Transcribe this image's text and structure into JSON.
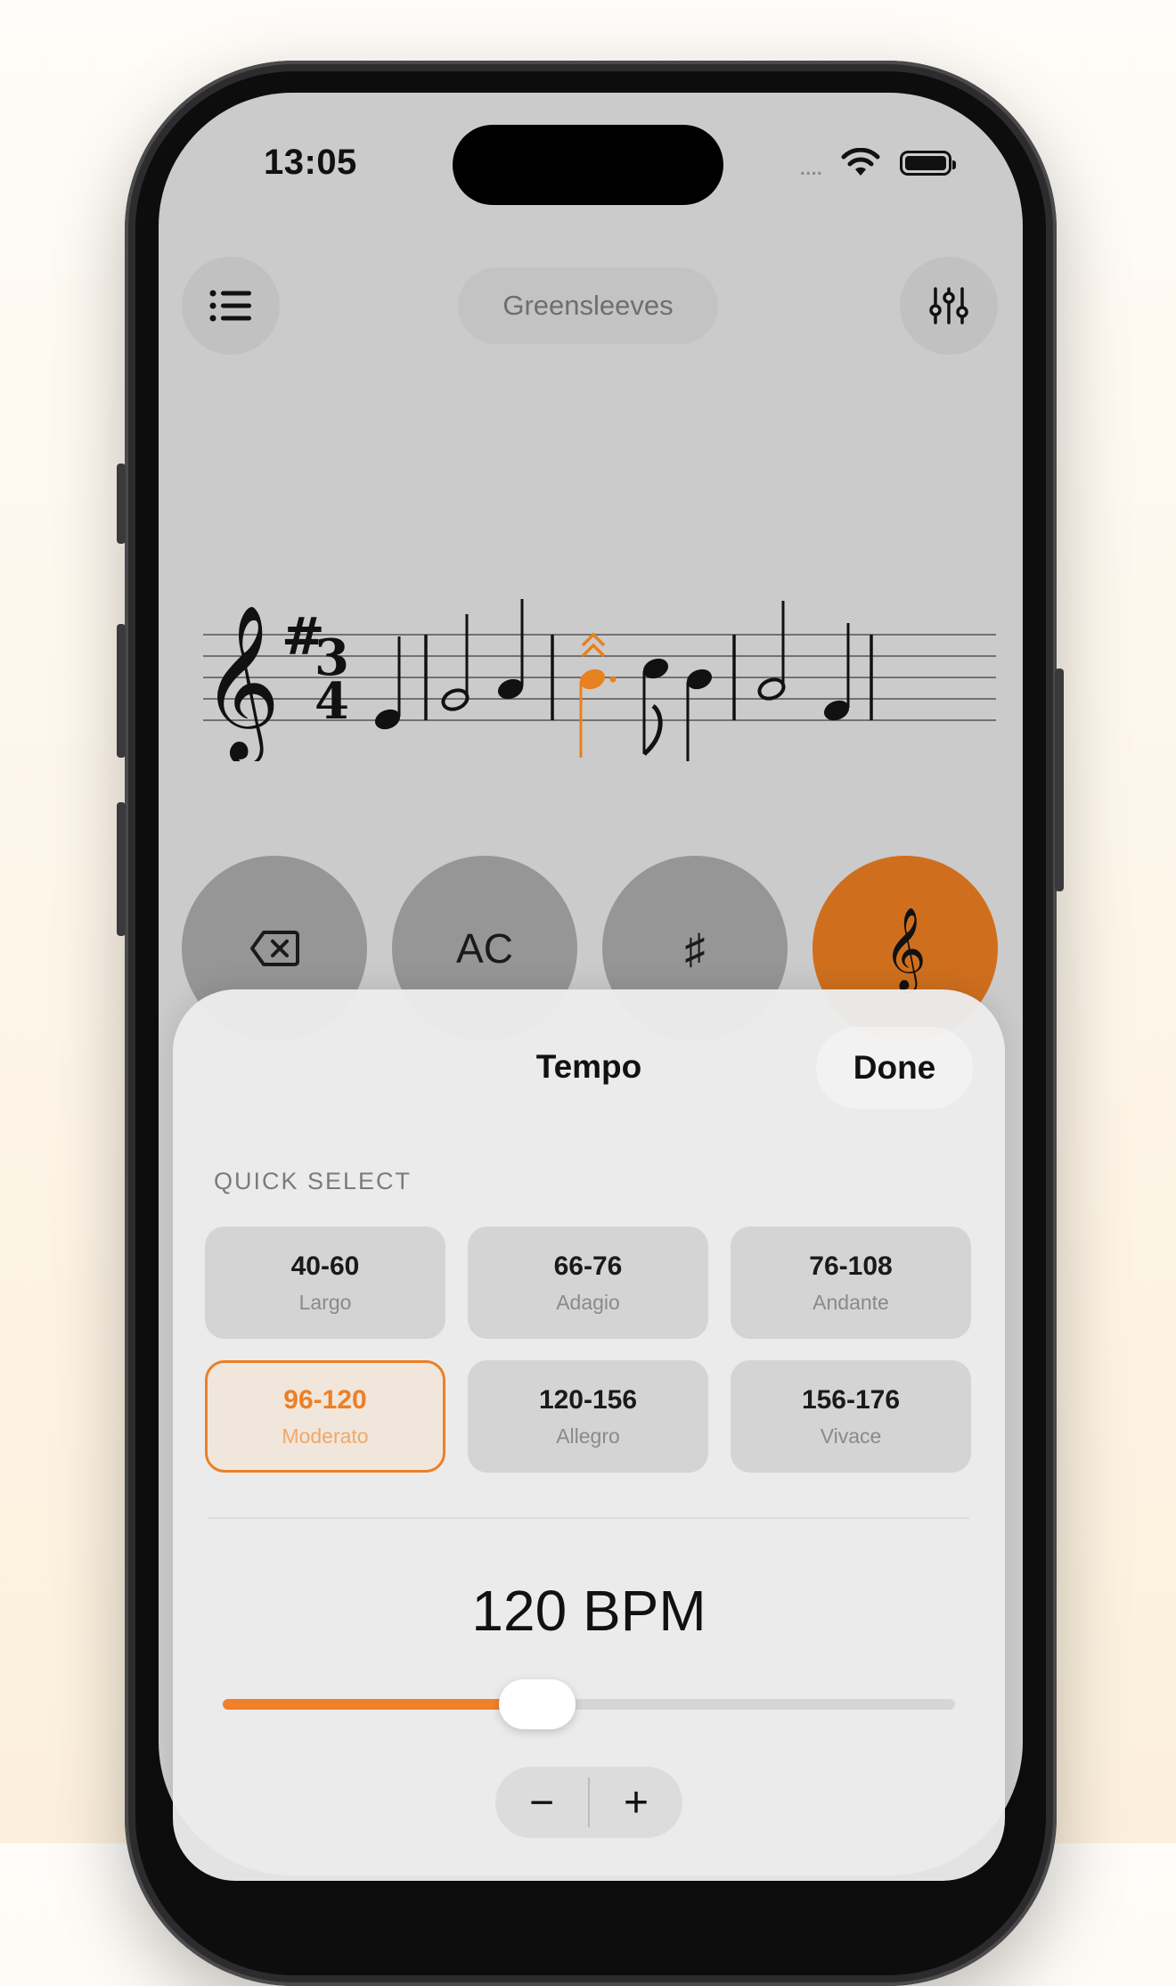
{
  "status": {
    "time": "13:05",
    "signal": "....",
    "battery": "full"
  },
  "header": {
    "menu_icon": "list-icon",
    "title": "Greensleeves",
    "mixer_icon": "sliders-icon"
  },
  "score": {
    "clef": "treble",
    "key_signature": "#",
    "time_signature": {
      "top": "3",
      "bottom": "4"
    }
  },
  "keypad": [
    {
      "icon": "delete-backspace-icon",
      "label": ""
    },
    {
      "icon": "",
      "label": "AC"
    },
    {
      "icon": "",
      "label": "♯"
    },
    {
      "icon": "treble-clef-icon",
      "label": "𝄞",
      "accent": "#cf6f1e"
    }
  ],
  "sheet": {
    "title": "Tempo",
    "done_label": "Done",
    "section_label": "QUICK SELECT",
    "presets": [
      {
        "range": "40-60",
        "name": "Largo"
      },
      {
        "range": "66-76",
        "name": "Adagio"
      },
      {
        "range": "76-108",
        "name": "Andante"
      },
      {
        "range": "96-120",
        "name": "Moderato",
        "selected": true
      },
      {
        "range": "120-156",
        "name": "Allegro"
      },
      {
        "range": "156-176",
        "name": "Vivace"
      }
    ],
    "bpm_label": "120 BPM",
    "slider": {
      "value_fraction": 0.43
    },
    "stepper": {
      "minus": "−",
      "plus": "+"
    }
  },
  "colors": {
    "accent": "#ec7f27",
    "note_highlight": "#e8811f"
  }
}
